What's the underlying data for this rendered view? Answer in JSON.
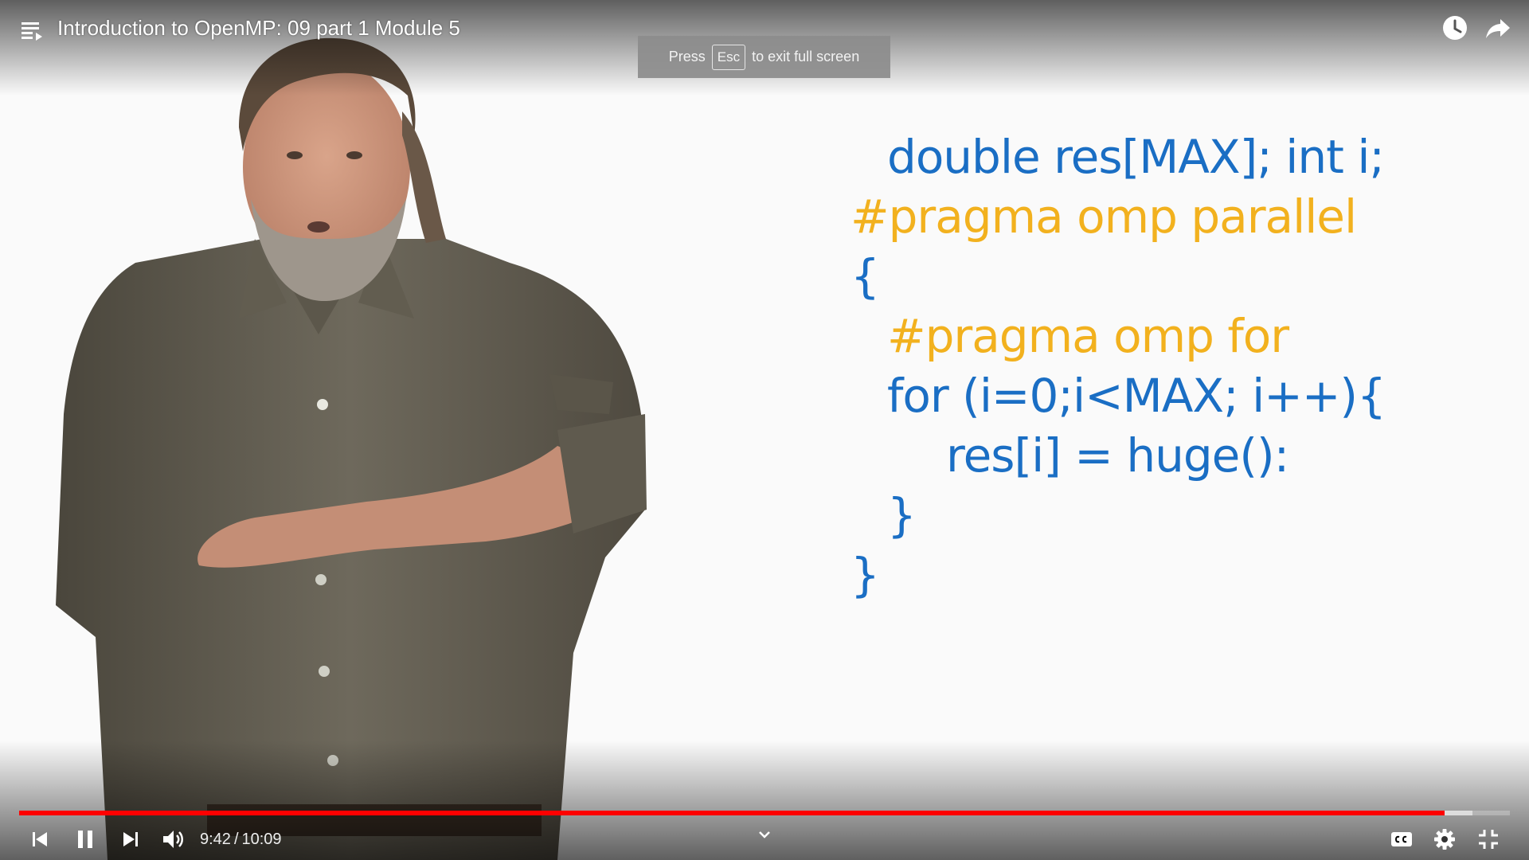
{
  "header": {
    "title": "Introduction to OpenMP: 09 part 1 Module 5",
    "playlist_icon": "playlist-icon",
    "watch_later_icon": "clock-icon",
    "share_icon": "share-arrow-icon"
  },
  "fullscreen_toast": {
    "prefix": "Press",
    "key": "Esc",
    "suffix": "to exit full screen"
  },
  "slide": {
    "code_lines": [
      {
        "text": "double res[MAX]; int i;",
        "color": "blue"
      },
      {
        "text": "#pragma omp parallel",
        "color": "gold"
      },
      {
        "text": "{",
        "color": "blue"
      },
      {
        "text": "#pragma omp for",
        "color": "gold"
      },
      {
        "text": "for (i=0;i<MAX; i++){",
        "color": "blue"
      },
      {
        "text": "res[i] = huge():",
        "color": "blue"
      },
      {
        "text": "}",
        "color": "blue"
      },
      {
        "text": "}",
        "color": "blue"
      }
    ],
    "colors": {
      "blue": "#1a6ec4",
      "gold": "#f2b11e"
    }
  },
  "player": {
    "current_time": "9:42",
    "duration": "10:09",
    "progress": 0.956,
    "buffered": 0.975,
    "progress_color": "#ff0000",
    "icons": {
      "previous": "previous-icon",
      "pause": "pause-icon",
      "next": "next-icon",
      "volume": "volume-icon",
      "chevron": "chevron-down-icon",
      "captions": "captions-icon",
      "settings": "gear-icon",
      "exit_fullscreen": "exit-fullscreen-icon"
    }
  }
}
